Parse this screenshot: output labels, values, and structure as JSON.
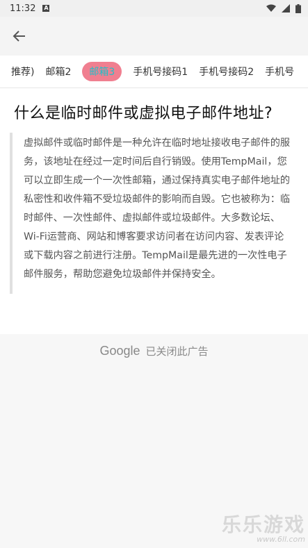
{
  "status_bar": {
    "time": "11:32",
    "notification_icon": "A"
  },
  "app_bar": {
    "back_icon": "arrow-left-icon"
  },
  "tabs": [
    {
      "label": "推荐)"
    },
    {
      "label": "邮箱2"
    },
    {
      "label": "邮箱3",
      "active": true
    },
    {
      "label": "手机号接码1"
    },
    {
      "label": "手机号接码2"
    },
    {
      "label": "手机号"
    }
  ],
  "article": {
    "title": "什么是临时邮件或虚拟电子邮件地址?",
    "body": "虚拟邮件或临时邮件是一种允许在临时地址接收电子邮件的服务，该地址在经过一定时间后自行销毁。使用TempMail，您可以立即生成一个一次性邮箱，通过保持真实电子邮件地址的私密性和收件箱不受垃圾邮件的影响而自毁。它也被称为：临时邮件、一次性邮件、虚拟邮件或垃圾邮件。大多数论坛、Wi-Fi运营商、网站和博客要求访问者在访问内容、发表评论或下载内容之前进行注册。TempMail是最先进的一次性电子邮件服务，帮助您避免垃圾邮件并保持安全。"
  },
  "ad": {
    "brand": "Google",
    "message": "已关闭此广告"
  },
  "watermark": {
    "main": "乐乐游戏",
    "sub": "www.6ll.com"
  },
  "colors": {
    "active_tab_bg": "#f07f90",
    "active_tab_text": "#20c0c8"
  }
}
